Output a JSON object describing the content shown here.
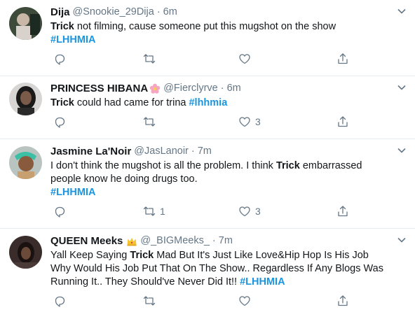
{
  "tweets": [
    {
      "name": "Dija",
      "handle": "@Snookie_29Dija",
      "separator": "·",
      "time": "6m",
      "body": [
        {
          "t": "Trick",
          "s": "b"
        },
        {
          "t": " not filming, cause someone put this mugshot on the show ",
          "s": ""
        },
        {
          "br": true
        },
        {
          "t": "#LHHMIA",
          "s": "tag"
        }
      ],
      "counts": {
        "reply": "",
        "retweet": "",
        "like": ""
      }
    },
    {
      "name": "PRINCESS HIBANA",
      "name_emoji": "cherry-blossom-emoji",
      "handle": "@Fierclyrve",
      "separator": "·",
      "time": "6m",
      "body": [
        {
          "t": "Trick",
          "s": "b"
        },
        {
          "t": " could had came for trina  ",
          "s": ""
        },
        {
          "t": "#lhhmia",
          "s": "tag"
        }
      ],
      "counts": {
        "reply": "",
        "retweet": "",
        "like": "3"
      }
    },
    {
      "name": "Jasmine La'Noir",
      "handle": "@JasLanoir",
      "separator": "·",
      "time": "7m",
      "body": [
        {
          "t": "I don't think the mugshot is all the problem. I think ",
          "s": ""
        },
        {
          "t": "Trick",
          "s": "b"
        },
        {
          "t": " embarrassed",
          "s": ""
        },
        {
          "br": true
        },
        {
          "t": "people know he doing drugs too.",
          "s": ""
        },
        {
          "br": true
        },
        {
          "t": "#LHHMIA",
          "s": "tag"
        }
      ],
      "counts": {
        "reply": "",
        "retweet": "1",
        "like": "3"
      }
    },
    {
      "name": "QUEEN Meeks",
      "name_emoji": "crown-emoji",
      "handle": "@_BIGMeeks_",
      "separator": "·",
      "time": "7m",
      "body": [
        {
          "t": "Yall Keep Saying ",
          "s": ""
        },
        {
          "t": "Trick",
          "s": "b"
        },
        {
          "t": " Mad But It's Just Like Love&Hip Hop Is His Job",
          "s": ""
        },
        {
          "br": true
        },
        {
          "t": "Why Would His Job Put That On The Show.. Regardless If Any Blogs Was",
          "s": ""
        },
        {
          "br": true
        },
        {
          "t": "Running It.. They Should've Never Did It!! ",
          "s": ""
        },
        {
          "t": "#LHHMIA",
          "s": "tag"
        }
      ],
      "counts": {
        "reply": "",
        "retweet": "",
        "like": ""
      }
    }
  ],
  "icons": {
    "reply": "reply-icon",
    "retweet": "retweet-icon",
    "like": "like-icon",
    "share": "share-icon",
    "menu": "chevron-down-icon"
  },
  "colors": {
    "hashtag": "#1b95e0",
    "secondary_text": "#657786",
    "divider": "#e6ecf0"
  }
}
